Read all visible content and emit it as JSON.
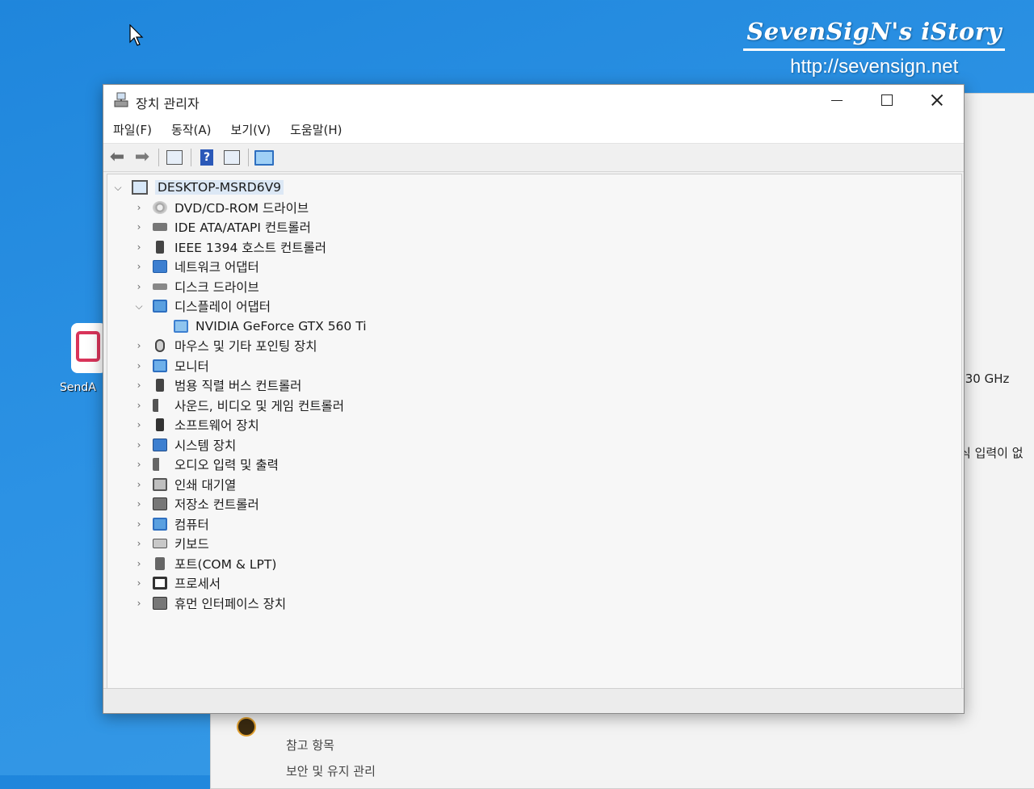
{
  "watermark": {
    "title": "SevenSigN's iStory",
    "url": "http://sevensign.net"
  },
  "desktop": {
    "icon_label": "SendA"
  },
  "background_window": {
    "cpu_speed": ".30 GHz",
    "input_text": "식 입력이 없",
    "ref_label": "참고 항목",
    "ref_label2": "보안 및 유지 관리"
  },
  "window": {
    "title": "장치 관리자",
    "menu": [
      "파일(F)",
      "동작(A)",
      "보기(V)",
      "도움말(H)"
    ],
    "toolbar": [
      "back-arrow",
      "forward-arrow",
      "properties-icon",
      "help-icon",
      "update-driver-icon",
      "scan-hardware-icon"
    ]
  },
  "tree": {
    "root": "DESKTOP-MSRD6V9",
    "categories": [
      {
        "label": "DVD/CD-ROM 드라이브",
        "icon": "disc-drive-icon",
        "expanded": false
      },
      {
        "label": "IDE ATA/ATAPI 컨트롤러",
        "icon": "ide-controller-icon",
        "expanded": false
      },
      {
        "label": "IEEE 1394 호스트 컨트롤러",
        "icon": "ieee1394-icon",
        "expanded": false
      },
      {
        "label": "네트워크 어댑터",
        "icon": "network-adapter-icon",
        "expanded": false
      },
      {
        "label": "디스크 드라이브",
        "icon": "disk-drive-icon",
        "expanded": false
      },
      {
        "label": "디스플레이 어댑터",
        "icon": "display-adapter-icon",
        "expanded": true
      },
      {
        "label": "NVIDIA GeForce GTX 560 Ti",
        "icon": "gpu-icon",
        "child": true
      },
      {
        "label": "마우스 및 기타 포인팅 장치",
        "icon": "mouse-icon",
        "expanded": false
      },
      {
        "label": "모니터",
        "icon": "monitor-icon",
        "expanded": false
      },
      {
        "label": "범용 직렬 버스 컨트롤러",
        "icon": "usb-controller-icon",
        "expanded": false
      },
      {
        "label": "사운드, 비디오 및 게임 컨트롤러",
        "icon": "sound-icon",
        "expanded": false
      },
      {
        "label": "소프트웨어 장치",
        "icon": "software-device-icon",
        "expanded": false
      },
      {
        "label": "시스템 장치",
        "icon": "system-device-icon",
        "expanded": false
      },
      {
        "label": "오디오 입력 및 출력",
        "icon": "audio-io-icon",
        "expanded": false
      },
      {
        "label": "인쇄 대기열",
        "icon": "printer-icon",
        "expanded": false
      },
      {
        "label": "저장소 컨트롤러",
        "icon": "storage-controller-icon",
        "expanded": false
      },
      {
        "label": "컴퓨터",
        "icon": "computer-icon",
        "expanded": false
      },
      {
        "label": "키보드",
        "icon": "keyboard-icon",
        "expanded": false
      },
      {
        "label": "포트(COM & LPT)",
        "icon": "port-icon",
        "expanded": false
      },
      {
        "label": "프로세서",
        "icon": "processor-icon",
        "expanded": false
      },
      {
        "label": "휴먼 인터페이스 장치",
        "icon": "hid-icon",
        "expanded": false
      }
    ]
  }
}
